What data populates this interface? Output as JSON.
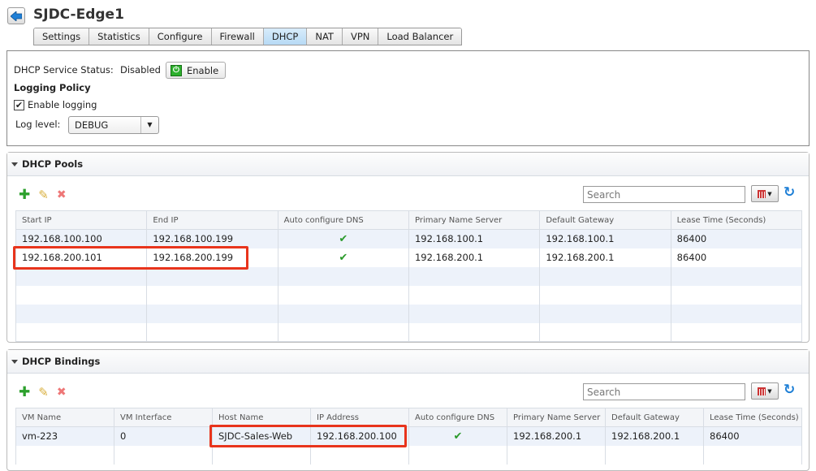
{
  "header": {
    "title": "SJDC-Edge1",
    "back_icon": "back-arrow-icon"
  },
  "tabs": [
    {
      "label": "Settings"
    },
    {
      "label": "Statistics"
    },
    {
      "label": "Configure"
    },
    {
      "label": "Firewall"
    },
    {
      "label": "DHCP",
      "active": true
    },
    {
      "label": "NAT"
    },
    {
      "label": "VPN"
    },
    {
      "label": "Load Balancer"
    }
  ],
  "service": {
    "label": "DHCP Service Status:",
    "status": "Disabled",
    "enable_button": "Enable"
  },
  "logging": {
    "heading": "Logging Policy",
    "enable_label": "Enable logging",
    "enabled": true,
    "level_label": "Log level:",
    "level_value": "DEBUG"
  },
  "pools": {
    "title": "DHCP Pools",
    "search_placeholder": "Search",
    "columns": [
      "Start IP",
      "End IP",
      "Auto configure DNS",
      "Primary Name Server",
      "Default Gateway",
      "Lease Time (Seconds)"
    ],
    "rows": [
      [
        "192.168.100.100",
        "192.168.100.199",
        "✔",
        "192.168.100.1",
        "192.168.100.1",
        "86400"
      ],
      [
        "192.168.200.101",
        "192.168.200.199",
        "✔",
        "192.168.200.1",
        "192.168.200.1",
        "86400"
      ]
    ]
  },
  "bindings": {
    "title": "DHCP Bindings",
    "search_placeholder": "Search",
    "columns": [
      "VM Name",
      "VM Interface",
      "Host Name",
      "IP Address",
      "Auto configure DNS",
      "Primary Name Server",
      "Default Gateway",
      "Lease Time (Seconds)"
    ],
    "rows": [
      [
        "vm-223",
        "0",
        "SJDC-Sales-Web",
        "192.168.200.100",
        "✔",
        "192.168.200.1",
        "192.168.200.1",
        "86400"
      ]
    ]
  },
  "colors": {
    "highlight": "#e8341c",
    "active_tab": "#b7daf5",
    "check": "#2a9a2a"
  }
}
